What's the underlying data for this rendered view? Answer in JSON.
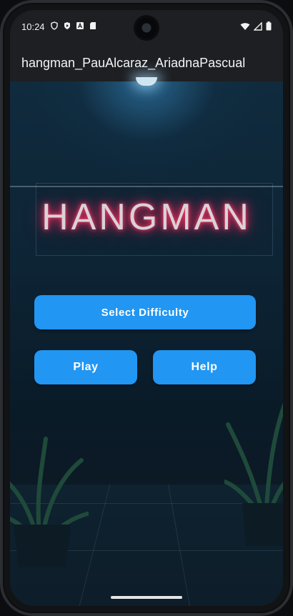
{
  "status_bar": {
    "time": "10:24",
    "left_icons": [
      "shield-icon",
      "shield-play-icon",
      "a-icon",
      "sd-card-icon"
    ],
    "right_icons": [
      "wifi-icon",
      "signal-icon",
      "battery-icon"
    ]
  },
  "app_bar": {
    "title": "hangman_PauAlcaraz_AriadnaPascual"
  },
  "background": {
    "sign_text": "HANGMAN",
    "neon_color": "#ff2a5f"
  },
  "buttons": {
    "select_difficulty": "Select Difficulty",
    "play": "Play",
    "help": "Help",
    "color": "#2196f3"
  }
}
